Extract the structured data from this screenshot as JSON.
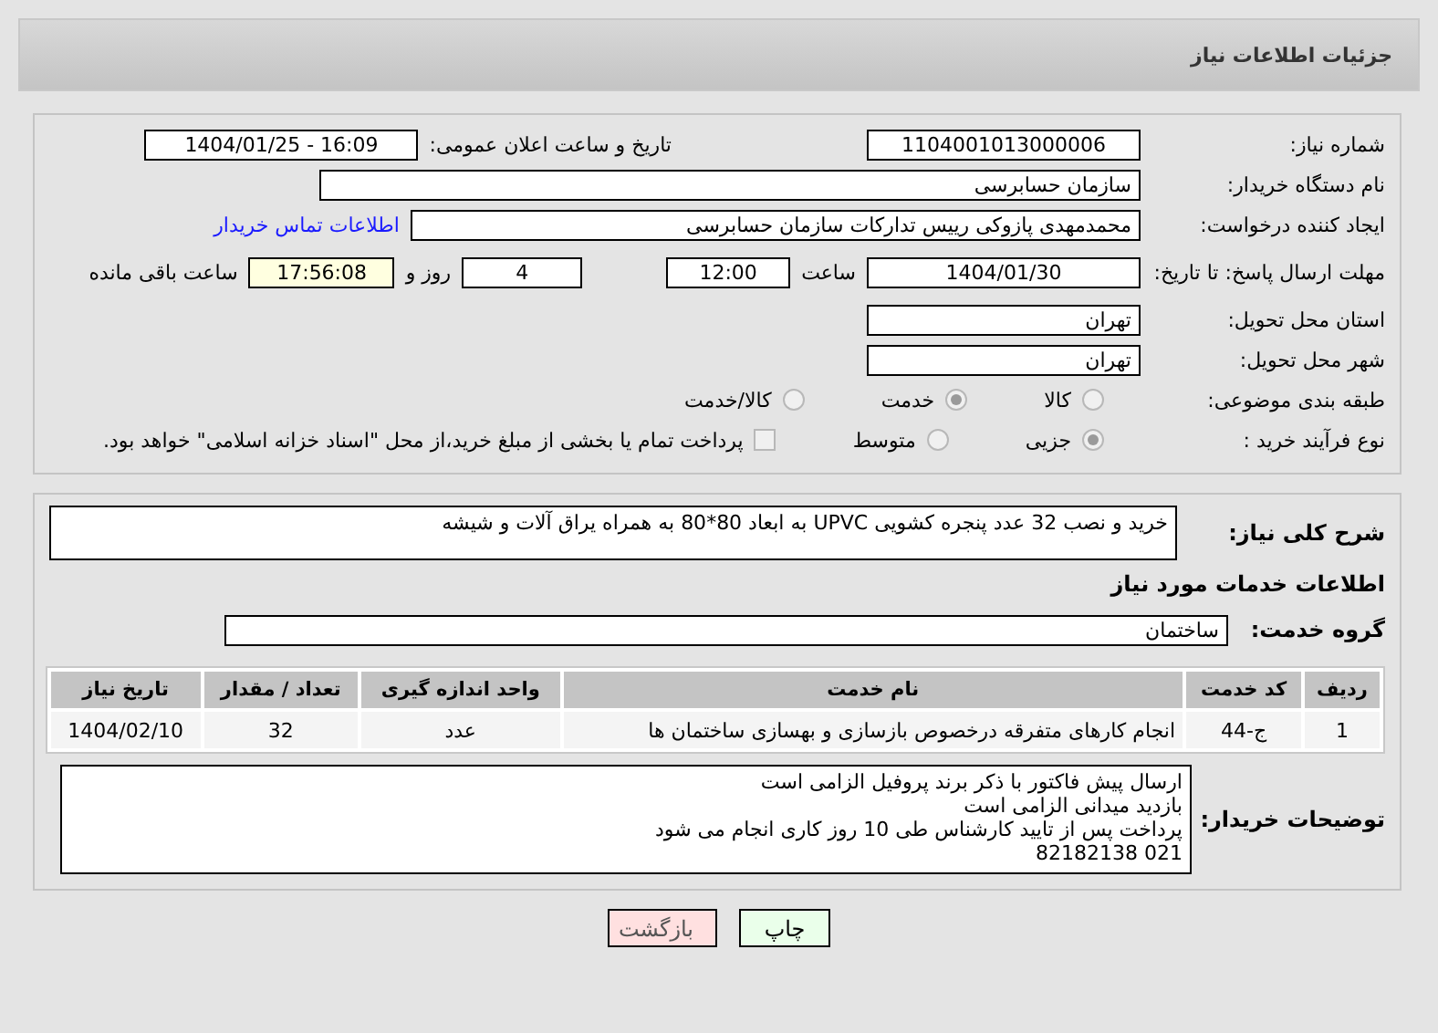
{
  "header": {
    "title": "جزئیات اطلاعات نیاز"
  },
  "need_number": {
    "label": "شماره نیاز:",
    "value": "1104001013000006"
  },
  "announce": {
    "label": "تاریخ و ساعت اعلان عمومی:",
    "value": "1404/01/25 - 16:09"
  },
  "buyer_org": {
    "label": "نام دستگاه خریدار:",
    "value": "سازمان حسابرسی"
  },
  "creator": {
    "label": "ایجاد کننده درخواست:",
    "value": "محمدمهدی پازوکی رییس تدارکات سازمان حسابرسی",
    "link": "اطلاعات تماس خریدار"
  },
  "deadline": {
    "label": "مهلت ارسال پاسخ: تا تاریخ:",
    "date": "1404/01/30",
    "time_label": "ساعت",
    "time": "12:00",
    "days": "4",
    "days_label": "روز و",
    "remaining": "17:56:08",
    "remaining_label": "ساعت باقی مانده"
  },
  "province": {
    "label": "استان محل تحویل:",
    "value": "تهران"
  },
  "city": {
    "label": "شهر محل تحویل:",
    "value": "تهران"
  },
  "category": {
    "label": "طبقه بندی موضوعی:",
    "options": [
      {
        "label": "کالا",
        "selected": false
      },
      {
        "label": "خدمت",
        "selected": true
      },
      {
        "label": "کالا/خدمت",
        "selected": false
      }
    ]
  },
  "process": {
    "label": "نوع فرآیند خرید :",
    "options": [
      {
        "label": "جزیی",
        "selected": true
      },
      {
        "label": "متوسط",
        "selected": false
      }
    ],
    "payment": {
      "checked": false,
      "text": "پرداخت تمام یا بخشی از مبلغ خرید،از محل \"اسناد خزانه اسلامی\" خواهد بود."
    }
  },
  "description": {
    "label": "شرح کلی نیاز:",
    "value": "خرید و نصب 32 عدد پنجره کشویی UPVC به ابعاد 80*80 به همراه یراق آلات و شیشه"
  },
  "services_title": "اطلاعات خدمات مورد نیاز",
  "service_group": {
    "label": "گروه خدمت:",
    "value": "ساختمان"
  },
  "table": {
    "columns": [
      "ردیف",
      "کد خدمت",
      "نام خدمت",
      "واحد اندازه گیری",
      "تعداد / مقدار",
      "تاریخ نیاز"
    ],
    "rows": [
      [
        "1",
        "ج-44",
        "انجام کارهای متفرقه درخصوص بازسازی و بهسازی ساختمان ها",
        "عدد",
        "32",
        "1404/02/10"
      ]
    ]
  },
  "buyer_notes": {
    "label": "توضیحات خریدار:",
    "lines": [
      "ارسال پیش فاکتور با ذکر برند پروفیل الزامی است",
      "بازدید میدانی الزامی است",
      "پرداخت پس از تایید کارشناس طی 10 روز کاری انجام می شود",
      "021 82182138"
    ]
  },
  "buttons": [
    {
      "label": "چاپ",
      "kind": "print"
    },
    {
      "label": "بازگشت",
      "kind": "back"
    }
  ]
}
